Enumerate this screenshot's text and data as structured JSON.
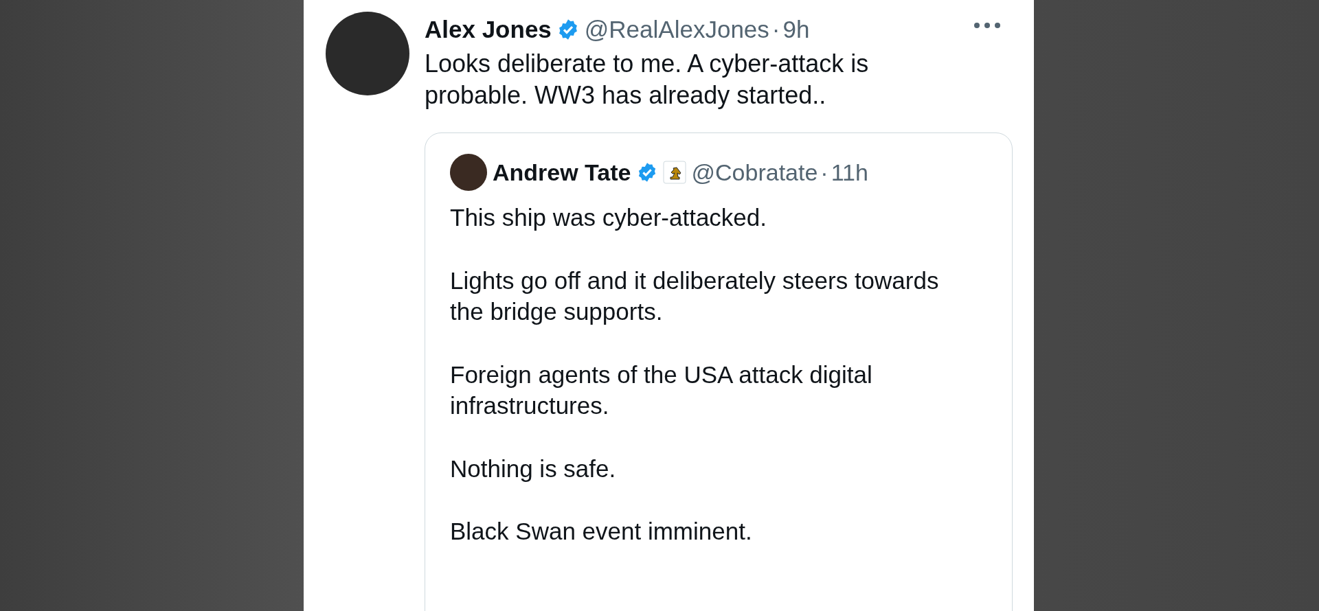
{
  "tweet": {
    "author": {
      "name": "Alex Jones",
      "verified": true,
      "handle": "@RealAlexJones",
      "separator": "·",
      "time": "9h"
    },
    "text": "Looks deliberate to me. A cyber-attack is probable. WW3 has already started..",
    "quote": {
      "author": {
        "name": "Andrew Tate",
        "verified": true,
        "handle": "@Cobratate",
        "separator": "·",
        "time": "11h"
      },
      "paragraphs": [
        "This ship was cyber-attacked.",
        "Lights go off and it deliberately steers towards the bridge supports.",
        "Foreign agents of the USA attack digital infrastructures.",
        "Nothing is safe.",
        "Black Swan event imminent."
      ]
    }
  }
}
